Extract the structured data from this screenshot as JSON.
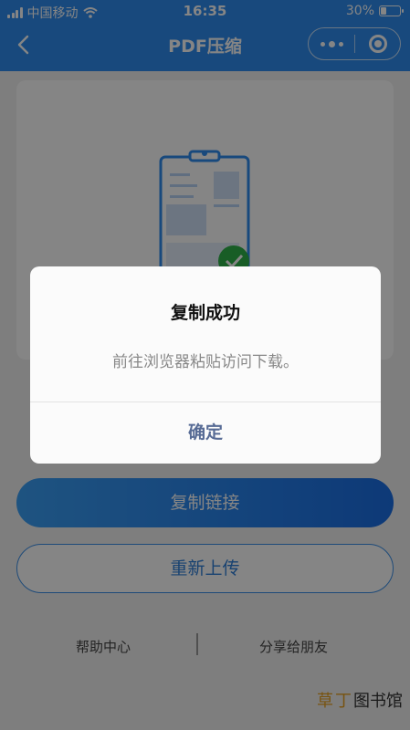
{
  "status_bar": {
    "carrier": "中国移动",
    "time": "16:35",
    "battery_text": "30%",
    "battery_level": 0.3
  },
  "nav": {
    "title": "PDF压缩"
  },
  "actions": {
    "copy_link": "复制链接",
    "reupload": "重新上传"
  },
  "footer": {
    "help": "帮助中心",
    "share": "分享给朋友"
  },
  "watermark": {
    "part1": "草",
    "part2": "丁",
    "part3": "图书馆"
  },
  "dialog": {
    "title": "复制成功",
    "message": "前往浏览器粘贴访问下载。",
    "confirm": "确定"
  },
  "colors": {
    "header": "#2f8df0",
    "primary_button": "#1a6ee6",
    "dialog_confirm": "#576b95",
    "success": "#2fb24a"
  },
  "icons": [
    "back-icon",
    "more-icon",
    "close-mini-program-icon",
    "signal-icon",
    "wifi-icon",
    "battery-icon",
    "document-icon",
    "success-check-icon"
  ]
}
